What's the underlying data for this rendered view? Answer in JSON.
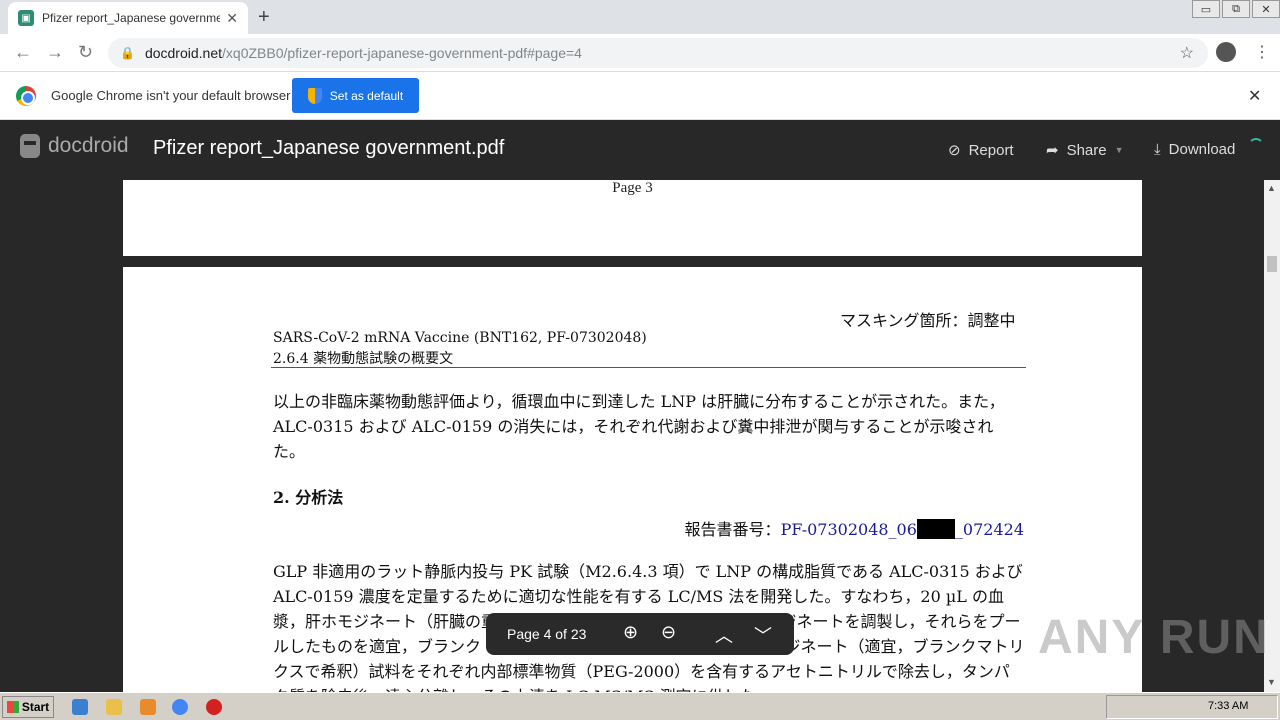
{
  "browser": {
    "tab_title": "Pfizer report_Japanese government",
    "tab_close": "✕",
    "new_tab": "+",
    "url_host": "docdroid.net",
    "url_path": "/xq0ZBB0/pfizer-report-japanese-government-pdf#page=4",
    "window_controls": [
      "▭",
      "⧉",
      "✕"
    ]
  },
  "infobar": {
    "message": "Google Chrome isn't your default browser",
    "button_label": "Set as default",
    "close": "✕"
  },
  "docdroid": {
    "brand": "docdroid",
    "document_title": "Pfizer report_Japanese government.pdf",
    "report_label": "Report",
    "share_label": "Share",
    "download_label": "Download",
    "accent_color": "#38b5a0"
  },
  "page3": {
    "label": "Page  3"
  },
  "page4": {
    "masking_note": "マスキング箇所：調整中",
    "vaccine_line": "SARS-CoV-2 mRNA Vaccine (BNT162, PF-07302048)",
    "section_line": "2.6.4  薬物動態試験の概要文",
    "paragraph1": "以上の非臨床薬物動態評価より，循環血中に到達した LNP は肝臓に分布することが示された。また，ALC-0315 および ALC-0159 の消失には，それぞれ代謝および糞中排泄が関与することが示唆された。",
    "heading2": "2. 分析法",
    "report_number_label": "報告書番号：",
    "report_number_prefix": "PF-07302048_06",
    "report_number_suffix": "_072424",
    "paragraph2": "GLP 非適用のラット静脈内投与 PK 試験（M2.6.4.3 項）で LNP の構成脂質である ALC-0315 および ALC-0159 濃度を定量するために適切な性能を有する LC/MS 法を開発した。すなわち，20 µL の血漿，肝ホモジネート（肝臓の重量の約 4 倍量の水を加えて調製），ホモジネートを調製し，それらをプールしたものを適宜，ブランク（ブランクマトリクス）に希釈し，糞ホモジネート（適宜，ブランクマトリクスで希釈）試料をそれぞれ内部標準物質（PEG-2000）を含有するアセトニトリルで除去し，タンパク質を除去後，遠心分離し，その上清を LC-MS/MS 測定に供した。"
  },
  "viewer_toolbar": {
    "page_indicator": "Page 4 of 23"
  },
  "watermark": "ANY RUN",
  "taskbar": {
    "start_label": "Start",
    "clock": "7:33 AM"
  }
}
